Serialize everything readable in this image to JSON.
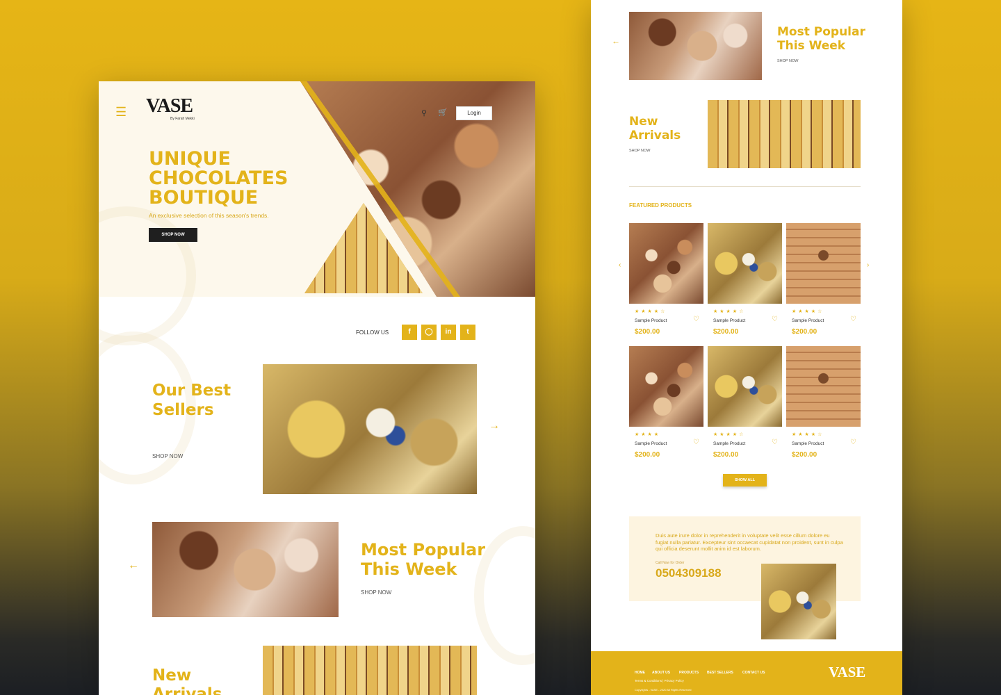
{
  "brand": {
    "logo": "VASE",
    "logo_sub": "By Farah Mekki",
    "accent": "#e3b31a",
    "dark": "#1f1f1f"
  },
  "header": {
    "menu_icon": "hamburger-icon",
    "search_icon": "search-icon",
    "cart_icon": "cart-icon",
    "login_label": "Login"
  },
  "hero": {
    "title": "UNIQUE CHOCOLATES BOUTIQUE",
    "subtitle": "An exclusive selection of this season's trends.",
    "shop_label": "SHOP NOW"
  },
  "follow": {
    "label": "FOLLOW US",
    "icons": [
      "facebook-icon",
      "instagram-icon",
      "linkedin-icon",
      "twitter-icon"
    ]
  },
  "sections": {
    "best_sellers": {
      "title": "Our Best Sellers",
      "shop_label": "SHOP NOW"
    },
    "most_popular": {
      "title": "Most Popular This Week",
      "shop_label": "SHOP NOW"
    },
    "new_arrivals": {
      "title": "New Arrivals",
      "shop_label": "SHOP NOW"
    }
  },
  "featured": {
    "label": "FEATURED PRODUCTS",
    "products": [
      {
        "name": "Sample Product",
        "price": "$200.00",
        "rating": 4.5
      },
      {
        "name": "Sample Product",
        "price": "$200.00",
        "rating": 4.5
      },
      {
        "name": "Sample Product",
        "price": "$200.00",
        "rating": 4.5
      },
      {
        "name": "Sample Product",
        "price": "$200.00",
        "rating": 4
      },
      {
        "name": "Sample Product",
        "price": "$200.00",
        "rating": 4.5
      },
      {
        "name": "Sample Product",
        "price": "$200.00",
        "rating": 4.5
      }
    ],
    "show_all_label": "SHOW ALL"
  },
  "contact": {
    "text": "Duis aute irure dolor in reprehenderit in voluptate velit esse cillum dolore eu fugiat nulla pariatur. Excepteur sint occaecat cupidatat non proident, sunt in culpa qui officia deserunt mollit anim id est laborum.",
    "call_label": "Call Now for Order",
    "phone": "0504309188"
  },
  "footer": {
    "links": [
      "HOME",
      "ABOUT US",
      "PRODUCTS",
      "BEST SELLERS",
      "CONTACT US"
    ],
    "terms": "Terms & Conditions  |  Privacy Policy",
    "copyright": "Copyrights - VASE - 2020 All Rights Reserved",
    "logo": "VASE"
  }
}
